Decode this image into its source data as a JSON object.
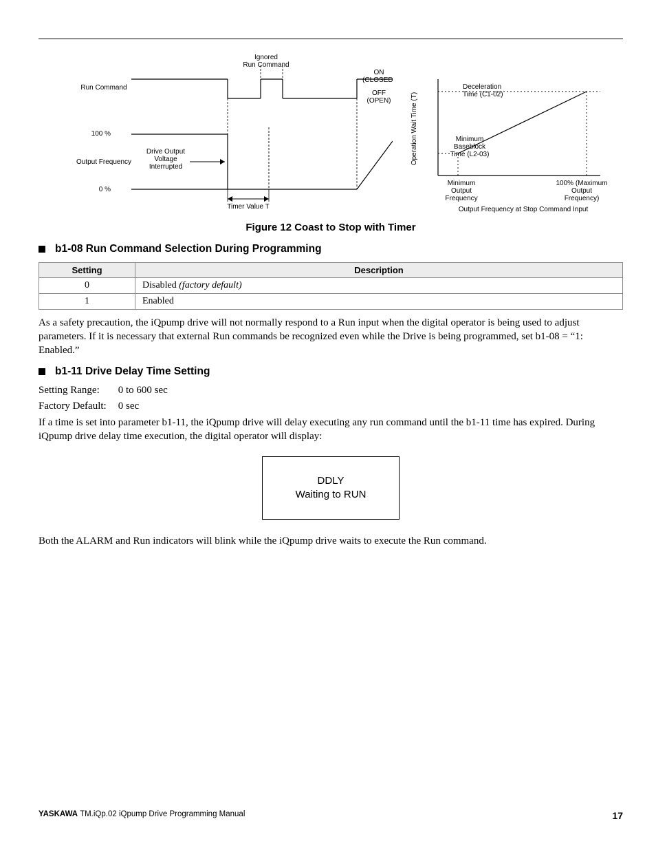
{
  "figure": {
    "left": {
      "ignored1": "Ignored",
      "ignored2": "Run Command",
      "run_command": "Run Command",
      "on": "ON",
      "closed": "(CLOSED)",
      "off": "OFF",
      "open": "(OPEN)",
      "pct100": "100 %",
      "pct0": "0 %",
      "drive_out1": "Drive Output",
      "drive_out2": "Voltage",
      "drive_out3": "Interrupted",
      "output_freq": "Output Frequency",
      "timer_value": "Timer Value T"
    },
    "right": {
      "yaxis": "Operation Wait Time (T)",
      "decel1": "Deceleration",
      "decel2": "Time (C1-02)",
      "min_bb1": "Minimum",
      "min_bb2": "Baseblock",
      "min_bb3": "Time (L2-03)",
      "min_of1": "Minimum",
      "min_of2": "Output",
      "min_of3": "Frequency",
      "max_of1": "100% (Maximum",
      "max_of2": "Output",
      "max_of3": "Frequency)",
      "xaxis": "Output Frequency at Stop Command Input"
    },
    "caption": "Figure 12  Coast to Stop with Timer"
  },
  "s1": {
    "title": "b1-08 Run Command Selection During Programming",
    "th_setting": "Setting",
    "th_desc": "Description",
    "rows": [
      {
        "setting": "0",
        "desc": "Disabled ",
        "desc_italic": "(factory default)"
      },
      {
        "setting": "1",
        "desc": "Enabled",
        "desc_italic": ""
      }
    ],
    "para": "As a safety precaution, the iQpump drive will not normally respond to a Run input when the digital operator is being used to adjust parameters. If it is necessary that external Run commands be recognized even while the Drive is being programmed, set b1-08 = “1: Enabled.”"
  },
  "s2": {
    "title": "b1-11 Drive Delay Time Setting",
    "range_k": "Setting Range:",
    "range_v": "0 to 600 sec",
    "default_k": "Factory Default:",
    "default_v": "0 sec",
    "para1": "If a time is set into parameter b1-11, the iQpump drive will delay executing any run command until the b1-11 time has expired. During iQpump drive delay time execution, the digital operator will display:",
    "display_l1": "DDLY",
    "display_l2": "Waiting to RUN",
    "para2": "Both the ALARM and Run indicators will blink while the iQpump drive waits to execute the Run command."
  },
  "footer": {
    "brand": "YASKAWA",
    "rest": " TM.iQp.02 iQpump Drive Programming Manual",
    "page": "17"
  },
  "chart_data": [
    {
      "type": "timing-diagram",
      "title": "Coast to Stop with Timer (left panel)",
      "signals": [
        {
          "name": "Run Command",
          "states": [
            "ON (CLOSED)",
            "OFF (OPEN)"
          ],
          "transitions": [
            "ON at start",
            "OFF at t1",
            "Ignored Run Command pulse during timer window",
            "OFF again after pulse"
          ]
        },
        {
          "name": "Output Frequency",
          "ylim": [
            "0 %",
            "100 %"
          ],
          "segments": [
            "100% until t1",
            "step to 0% at t1 (Drive Output Voltage Interrupted)",
            "0% during Timer Value T",
            "ramp back to 100% after timer window"
          ]
        }
      ],
      "x_axis": "time (unscaled)",
      "annotations": [
        "Timer Value T spans from Run Command OFF to end of wait window"
      ]
    },
    {
      "type": "line",
      "title": "Operation Wait Time vs Output Frequency (right panel)",
      "xlabel": "Output Frequency at Stop Command Input",
      "ylabel": "Operation Wait Time (T)",
      "x_ticks": [
        "Minimum Output Frequency",
        "100% (Maximum Output Frequency)"
      ],
      "y_reference_lines": [
        "Minimum Baseblock Time (L2-03)",
        "Deceleration Time (C1-02)"
      ],
      "series": [
        {
          "name": "Wait Time",
          "points": [
            {
              "x": "Minimum Output Frequency",
              "y": "Minimum Baseblock Time (L2-03)"
            },
            {
              "x": "100% (Maximum Output Frequency)",
              "y": "Deceleration Time (C1-02)"
            }
          ],
          "shape": "linear"
        }
      ]
    }
  ]
}
